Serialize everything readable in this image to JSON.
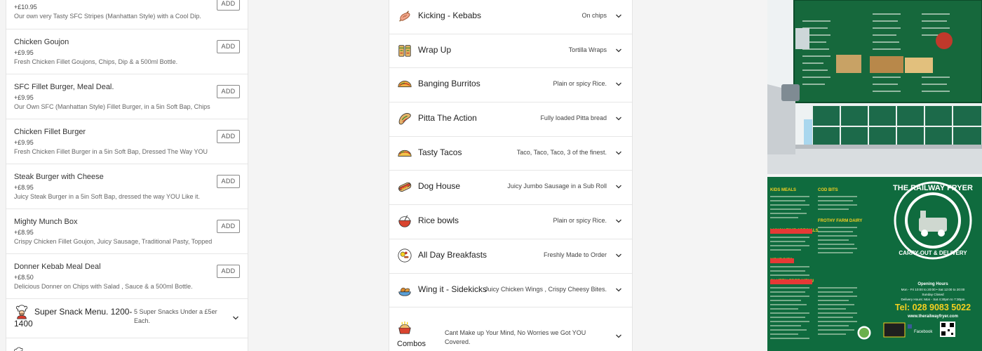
{
  "menu_items": [
    {
      "name": "",
      "price": "+£10.95",
      "desc": "Our own very Tasty SFC Stripes (Manhattan Style) with a Cool Dip.",
      "add_label": "ADD"
    },
    {
      "name": "Chicken Goujon",
      "price": "+£9.95",
      "desc": "Fresh Chicken Fillet Goujons, Chips, Dip & a 500ml Bottle.",
      "add_label": "ADD"
    },
    {
      "name": "SFC Fillet Burger, Meal Deal.",
      "price": "+£9.95",
      "desc": "Our Own SFC (Manhattan Style) Fillet Burger, in a 5in Soft Bap, Chips",
      "add_label": "ADD"
    },
    {
      "name": "Chicken Fillet Burger",
      "price": "+£9.95",
      "desc": "Fresh Chicken Fillet Burger in a 5in Soft Bap, Dressed The Way YOU",
      "add_label": "ADD"
    },
    {
      "name": "Steak Burger with Cheese",
      "price": "+£8.95",
      "desc": "Juicy Steak Burger in a 5in Soft Bap, dressed the way YOU Like it.",
      "add_label": "ADD"
    },
    {
      "name": "Mighty Munch Box",
      "price": "+£8.95",
      "desc": "Crispy Chicken Fillet Goujon, Juicy Sausage, Traditional Pasty, Topped",
      "add_label": "ADD"
    },
    {
      "name": "Donner Kebab Meal Deal",
      "price": "+£8.50",
      "desc": "Delicious Donner on Chips with Salad , Sauce & a 500ml Bottle.",
      "add_label": "ADD"
    }
  ],
  "left_category": {
    "title": "Super Snack Menu. 1200-1400",
    "subtitle": "5 Super Snacks Under a £5er Each.",
    "icon": "chef-icon"
  },
  "categories": [
    {
      "name": "Kicking - Kebabs",
      "subtitle": "On chips",
      "icon": "kebab-icon"
    },
    {
      "name": "Wrap Up",
      "subtitle": "Tortilla Wraps",
      "icon": "wrap-icon"
    },
    {
      "name": "Banging Burritos",
      "subtitle": "Plain or spicy Rice.",
      "icon": "burrito-icon"
    },
    {
      "name": "Pitta The Action",
      "subtitle": "Fully loaded Pitta bread",
      "icon": "pitta-icon"
    },
    {
      "name": "Tasty Tacos",
      "subtitle": "Taco, Taco, Taco, 3 of the finest.",
      "icon": "taco-icon"
    },
    {
      "name": "Dog House",
      "subtitle": "Juicy Jumbo Sausage in a Sub Roll",
      "icon": "hotdog-icon"
    },
    {
      "name": "Rice bowls",
      "subtitle": "Plain or spicy Rice.",
      "icon": "rice-bowl-icon"
    },
    {
      "name": "All Day Breakfasts",
      "subtitle": "Freshly Made to Order",
      "icon": "breakfast-icon"
    },
    {
      "name": "Wing it - Sidekicks",
      "subtitle": "Juicy Chicken Wings , Crispy Cheesy Bites.",
      "icon": "wings-icon"
    },
    {
      "name": "Combos",
      "subtitle": "Cant Make up Your Mind, No Worries we Got YOU Covered.",
      "icon": "combo-icon"
    }
  ],
  "flyer": {
    "brand": "THE RAILWAY FRYER",
    "tagline": "CARRY-OUT & DELIVERY",
    "phone": "Tel: 028 9083 5022",
    "website": "www.therailwayfryer.com",
    "hours_title": "Opening Hours",
    "hours": "Mon - Fri 10:00 to 20:00 • Sat 12:00 to 20:00",
    "sunday": "Sunday Closed",
    "delivery": "Delivery Hours: Mon - Sat 4:30pm to 7:30pm",
    "facebook": "Facebook"
  },
  "colors": {
    "flyer_green": "#0f6b3e",
    "accent_red": "#e53935",
    "accent_yellow": "#f5d020"
  }
}
